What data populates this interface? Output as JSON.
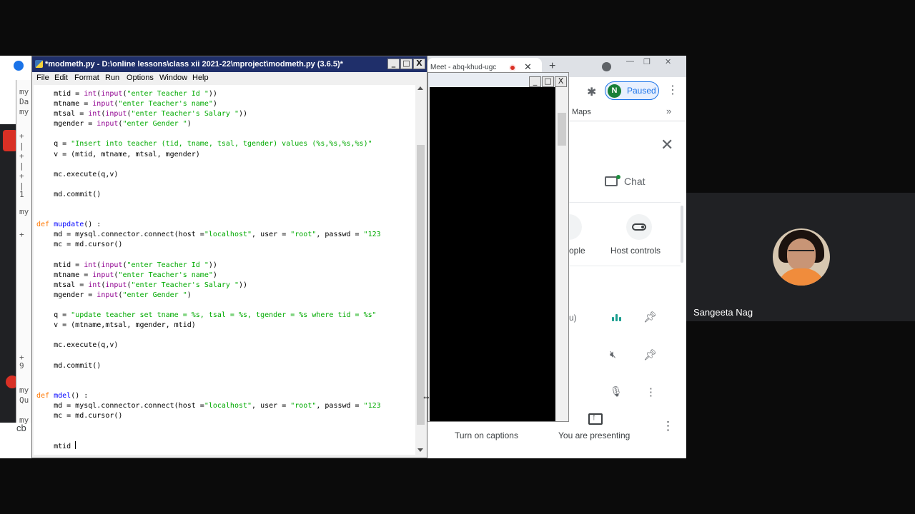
{
  "browser": {
    "tab_title": "Meet - abq-khud-ugc",
    "tab_close": "✕",
    "new_tab": "+",
    "profile_initial": "N",
    "profile_status": "Paused",
    "bookmark_maps": "Maps",
    "bookmark_more": "»",
    "win_controls": [
      "—",
      "❐",
      "✕"
    ]
  },
  "meet": {
    "chat_label": "Chat",
    "people_label_partial": "ople",
    "host_controls_label": "Host controls",
    "participant_partial": "u)",
    "captions_label": "Turn on captions",
    "presenting_label": "You are presenting",
    "participant_name": "Sangeeta Nag"
  },
  "idle": {
    "title": "*modmeth.py - D:\\online lessons\\class xii 2021-22\\mproject\\modmeth.py (3.6.5)*",
    "menu": [
      "File",
      "Edit",
      "Format",
      "Run",
      "Options",
      "Window",
      "Help"
    ],
    "win_buttons": [
      "_",
      "□",
      "X"
    ]
  },
  "popup": {
    "win_buttons": [
      "_",
      "□",
      "X"
    ]
  },
  "left_edge": {
    "strip_text": [
      "my",
      "Da",
      "my",
      "+",
      "|",
      "+",
      "|",
      "+",
      "|",
      "1",
      "my",
      "+",
      "|",
      "|",
      "|",
      "|",
      "|",
      "|",
      "|",
      "|",
      "|",
      "|",
      "|",
      "|",
      "+",
      "9",
      "|",
      "my",
      "Qu",
      "my"
    ],
    "bottom_label": "cb"
  },
  "colors": {
    "idle_titlebar": "#1f2f6a",
    "keyword": "#ff7700",
    "builtin": "#900090",
    "string": "#00aa00",
    "def_name": "#0000ff",
    "meet_speaking": "#1a9e8f"
  }
}
